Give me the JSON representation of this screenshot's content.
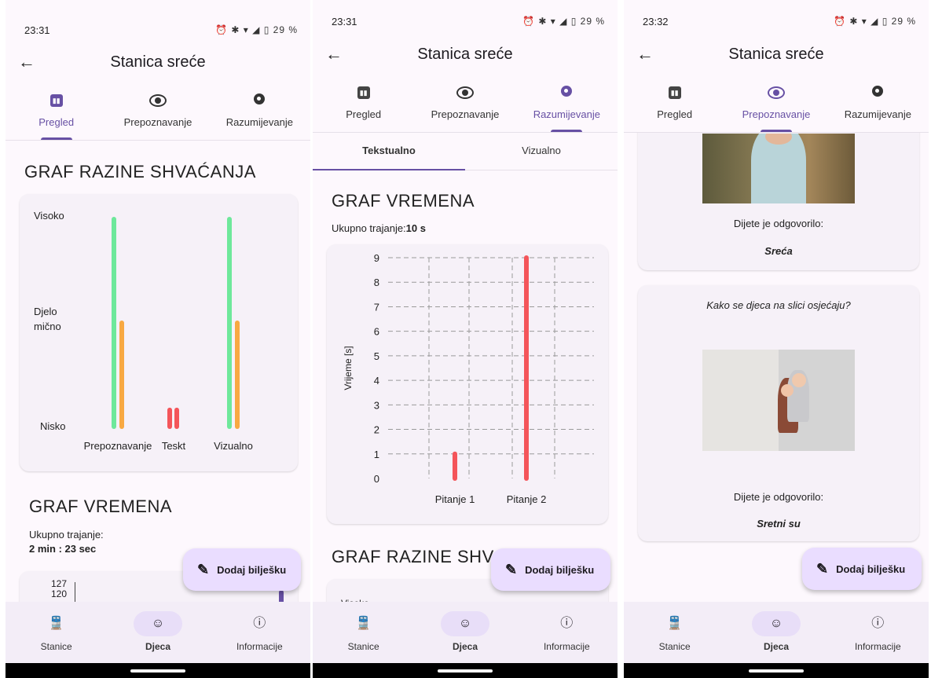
{
  "status": [
    {
      "time": "23:31",
      "icons": "⏰ ✱ ▾ ◢ ▯ 29 %"
    },
    {
      "time": "23:31",
      "icons": "⏰ ✱ ▾ ◢ ▯ 29 %"
    },
    {
      "time": "23:32",
      "icons": "⏰ ✱ ▾ ◢ ▯ 29 %"
    }
  ],
  "appbar": {
    "title": "Stanica sreće",
    "back": "←"
  },
  "tabs": [
    "Pregled",
    "Prepoznavanje",
    "Razumijevanje"
  ],
  "subtabs": [
    "Tekstualno",
    "Vizualno"
  ],
  "nav": [
    "Stanice",
    "Djeca",
    "Informacije"
  ],
  "fab_label": "Dodaj bilješku",
  "colors": {
    "primary": "#6750a4",
    "green": "#6ee89b",
    "orange": "#f8a942",
    "red": "#f4555a",
    "fab": "#eaddff"
  },
  "screen1": {
    "section_title": "GRAF RAZINE SHVAĆANJA",
    "time_title": "GRAF VREMENA",
    "total_label": "Ukupno trajanje:",
    "total_value": "2 min : 23 sec",
    "time_ticks": [
      "127",
      "120"
    ]
  },
  "screen2": {
    "section_title": "GRAF VREMENA",
    "total_label": "Ukupno trajanje:",
    "total_value": "10 s",
    "next_title": "GRAF RAZINE SHVA",
    "next_card_text": "Visoko"
  },
  "screen3": {
    "answer_label": "Dijete je odgovorilo:",
    "answer1": "Sreća",
    "question2": "Kako se djeca na slici osjećaju?",
    "answer2": "Sretni su"
  },
  "chart_data": [
    {
      "type": "bar",
      "categories": [
        "Prepoznavanje",
        "Teskt",
        "Vizualno"
      ],
      "yticks": [
        "Nisko",
        "Djelo\nmično",
        "Visoko"
      ],
      "ylim": [
        0,
        2
      ],
      "series": [
        {
          "color": "#6ee89b",
          "values": [
            2,
            null,
            2
          ]
        },
        {
          "color": "#f8a942",
          "values": [
            1,
            null,
            1
          ]
        },
        {
          "color": "#f4555a",
          "values": [
            null,
            0.16,
            null
          ]
        },
        {
          "color": "#f4555a",
          "values": [
            null,
            0.16,
            null
          ]
        }
      ]
    },
    {
      "type": "bar",
      "categories": [
        "Pitanje 1",
        "Pitanje 2"
      ],
      "values": [
        1,
        9
      ],
      "ylabel": "Vrijeme [s]",
      "ylim": [
        0,
        9
      ],
      "yticks": [
        0,
        1,
        2,
        3,
        4,
        5,
        6,
        7,
        8,
        9
      ],
      "grid": true
    }
  ]
}
